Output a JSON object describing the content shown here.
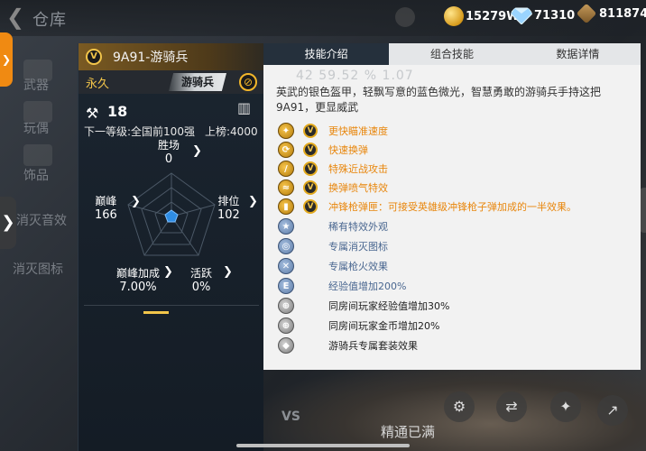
{
  "header": {
    "back_glyph": "❮",
    "title": "仓库",
    "currencies": [
      {
        "icon": "gold-coin-icon",
        "value": "15279W"
      },
      {
        "icon": "diamond-icon",
        "value": "71310"
      },
      {
        "icon": "token-icon",
        "value": "811874"
      }
    ]
  },
  "leftnav": {
    "items": [
      "武器",
      "玩偶",
      "饰品",
      "消灭音效",
      "消灭图标"
    ]
  },
  "card": {
    "rank_badge": "V",
    "weapon_name": "9A91-游骑兵",
    "duration": "永久",
    "class_tag": "游骑兵",
    "level": "18",
    "next_level": "下一等级:全国前100强",
    "top_rank": "上榜:4000",
    "stats": {
      "wins": {
        "label": "胜场",
        "value": "0"
      },
      "peak": {
        "label": "巅峰",
        "value": "166"
      },
      "ranking": {
        "label": "排位",
        "value": "102"
      },
      "peak_bonus": {
        "label": "巅峰加成",
        "value": "7.00%"
      },
      "activity": {
        "label": "活跃",
        "value": "0%"
      }
    }
  },
  "panel": {
    "tabs": [
      "技能介绍",
      "组合技能",
      "数据详情"
    ],
    "active_tab": 0,
    "ghost_stats": "42    59.52 %    1.07",
    "description": "英武的银色盔甲，轻飘写意的蓝色微光，智慧勇敢的游骑兵手持这把9A91，更显威武",
    "skills": [
      {
        "text": "更快瞄准速度",
        "style": "orange",
        "icon": "aim-speed-icon",
        "badge": "V"
      },
      {
        "text": "快速换弹",
        "style": "orange",
        "icon": "reload-icon",
        "badge": "V"
      },
      {
        "text": "特殊近战攻击",
        "style": "orange",
        "icon": "melee-icon",
        "badge": "V"
      },
      {
        "text": "换弹喷气特效",
        "style": "orange",
        "icon": "jet-effect-icon",
        "badge": "V"
      },
      {
        "text": "冲锋枪弹匣：可接受英雄级冲锋枪子弹加成的一半效果。",
        "style": "orange",
        "icon": "magazine-icon",
        "badge": "V"
      },
      {
        "text": "稀有特效外观",
        "style": "blue",
        "icon": "star-icon"
      },
      {
        "text": "专属消灭图标",
        "style": "blue",
        "icon": "kill-icon"
      },
      {
        "text": "专属枪火效果",
        "style": "blue",
        "icon": "muzzle-fire-icon"
      },
      {
        "text": "经验值增加200%",
        "style": "blue",
        "icon": "exp-icon"
      },
      {
        "text": "同房间玩家经验值增加30%",
        "style": "black",
        "icon": "room-exp-icon"
      },
      {
        "text": "同房间玩家金币增加20%",
        "style": "black",
        "icon": "room-gold-icon"
      },
      {
        "text": "游骑兵专属套装效果",
        "style": "black",
        "icon": "suit-icon"
      }
    ]
  },
  "bottom": {
    "refine_label": "精通已满",
    "vs": "VS"
  }
}
